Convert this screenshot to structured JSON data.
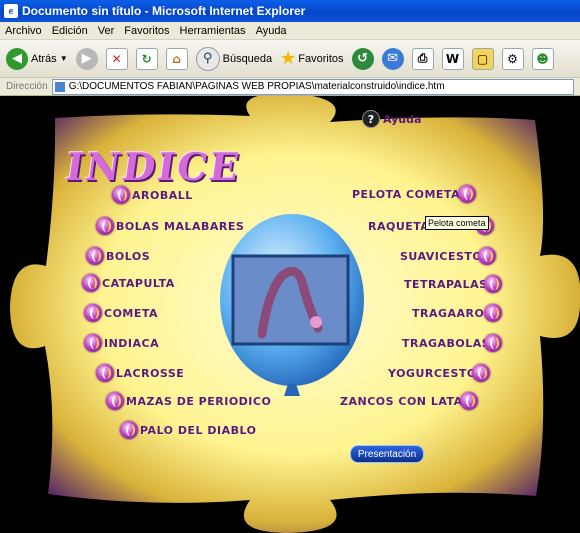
{
  "window": {
    "title": "Documento sin título - Microsoft Internet Explorer"
  },
  "menubar": [
    "Archivo",
    "Edición",
    "Ver",
    "Favoritos",
    "Herramientas",
    "Ayuda"
  ],
  "toolbar": {
    "back": "Atrás",
    "search": "Búsqueda",
    "favorites": "Favoritos"
  },
  "address": {
    "label": "Dirección",
    "value": "G:\\DOCUMENTOS FABIAN\\PAGINAS WEB PROPIAS\\materialconstruido\\indice.htm"
  },
  "page": {
    "title": "INDICE",
    "help": "Ayuda",
    "presentation": "Presentación",
    "tooltip": "Pelota cometa",
    "left_items": [
      "AROBALL",
      "BOLAS MALABARES",
      "BOLOS",
      "CATAPULTA",
      "COMETA",
      "INDIACA",
      "LACROSSE",
      "MAZAS DE PERIODICO",
      "PALO DEL DIABLO"
    ],
    "right_items": [
      "PELOTA COMETA",
      "RAQUETA",
      "SUAVICESTO",
      "TETRAPALAS",
      "TRAGAAROS",
      "TRAGABOLAS",
      "YOGURCESTO",
      "ZANCOS CON LATAS"
    ]
  },
  "colors": {
    "puzzle": "#fff8a0",
    "purple": "#5b1a7a",
    "balloon": "#4aa3e8"
  }
}
